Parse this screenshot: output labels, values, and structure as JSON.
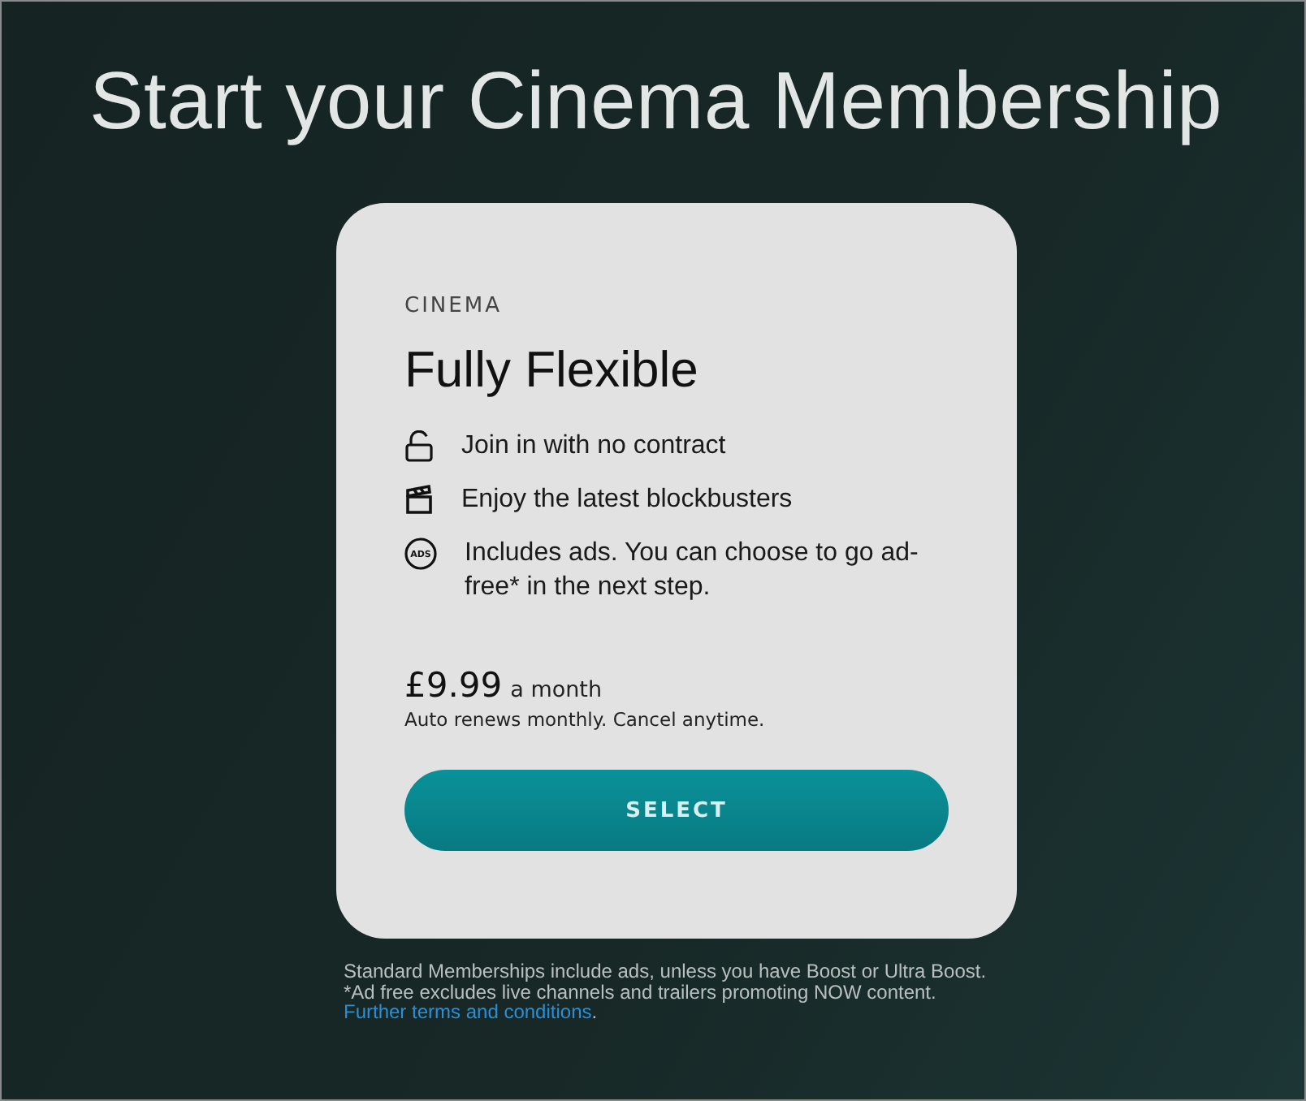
{
  "heading": "Start your Cinema Membership",
  "plan": {
    "category": "CINEMA",
    "name": "Fully Flexible",
    "features": [
      {
        "kind": "lock",
        "text": "Join in with no contract"
      },
      {
        "kind": "clapper",
        "text": "Enjoy the latest blockbusters"
      },
      {
        "kind": "ads",
        "icon_text": "ADS",
        "text": "Includes ads. You can choose to go ad-free* in the next step."
      }
    ],
    "price": "£9.99",
    "period": "a month",
    "renewal": "Auto renews monthly. Cancel anytime.",
    "button": "SELECT"
  },
  "footnote": {
    "text": "Standard Memberships include ads, unless you have Boost or Ultra Boost. *Ad free excludes live channels and trailers promoting NOW content.",
    "link": "Further terms and conditions",
    "suffix": "."
  }
}
